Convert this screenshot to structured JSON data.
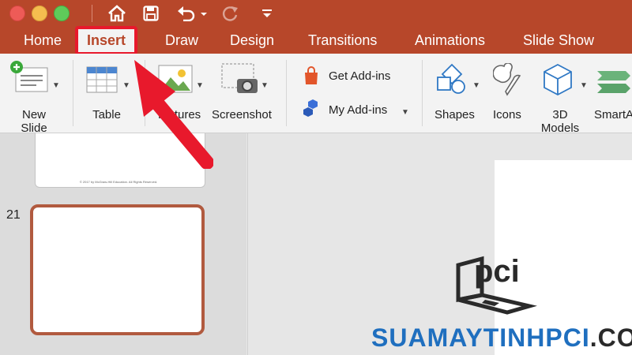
{
  "titlebar": {
    "quick_access": [
      "home-icon",
      "save-icon",
      "undo-icon",
      "redo-icon",
      "customize-icon"
    ]
  },
  "tabs": [
    {
      "label": "Home"
    },
    {
      "label": "Insert",
      "active": true
    },
    {
      "label": "Draw"
    },
    {
      "label": "Design"
    },
    {
      "label": "Transitions"
    },
    {
      "label": "Animations"
    },
    {
      "label": "Slide Show"
    }
  ],
  "ribbon": {
    "new_slide": {
      "line1": "New",
      "line2": "Slide"
    },
    "table": "Table",
    "pictures": "Pictures",
    "screenshot": "Screenshot",
    "get_addins": "Get Add-ins",
    "my_addins": "My Add-ins",
    "shapes": "Shapes",
    "icons": "Icons",
    "models": {
      "line1": "3D",
      "line2": "Models"
    },
    "smartart": "SmartA"
  },
  "slides": {
    "thumb20_footer": "© 2017 by McGraw-Hill Education. All Rights Reserved.",
    "thumb21_number": "21"
  },
  "watermark": {
    "brand": "pci",
    "url_part1": "SUAMAYTINHPCI",
    "url_part2": ".COM"
  },
  "colors": {
    "accent": "#b7472a",
    "highlight": "#e8192c",
    "arrow": "#e8192c",
    "watermark_blue": "#1f6fbf",
    "watermark_dark": "#2a2a2a"
  }
}
